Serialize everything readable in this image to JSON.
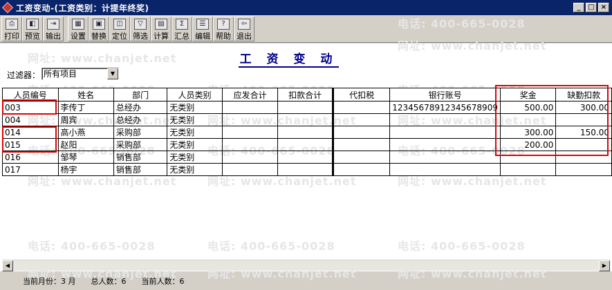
{
  "window": {
    "title": "工资变动-(工资类别：计提年终奖)",
    "minimize": "_",
    "restore": "□",
    "close": "×"
  },
  "toolbar": [
    {
      "label": "打印",
      "icon": "printer-icon",
      "glyph": "⎙"
    },
    {
      "label": "预览",
      "icon": "preview-icon",
      "glyph": "◧"
    },
    {
      "label": "输出",
      "icon": "export-icon",
      "glyph": "⇥"
    },
    {
      "label": "设置",
      "icon": "settings-icon",
      "glyph": "▦"
    },
    {
      "label": "替换",
      "icon": "replace-icon",
      "glyph": "▣"
    },
    {
      "label": "定位",
      "icon": "locate-icon",
      "glyph": "◫"
    },
    {
      "label": "筛选",
      "icon": "filter-icon",
      "glyph": "▽"
    },
    {
      "label": "计算",
      "icon": "calculate-icon",
      "glyph": "▤"
    },
    {
      "label": "汇总",
      "icon": "summary-icon",
      "glyph": "Σ"
    },
    {
      "label": "编辑",
      "icon": "edit-icon",
      "glyph": "☰"
    },
    {
      "label": "帮助",
      "icon": "help-icon",
      "glyph": "?"
    },
    {
      "label": "退出",
      "icon": "exit-icon",
      "glyph": "⇦"
    }
  ],
  "page_title": "工 资 变 动",
  "filter": {
    "label": "过滤器：",
    "value": "所有项目"
  },
  "columns": [
    "人员编号",
    "姓名",
    "部门",
    "人员类别",
    "应发合计",
    "扣款合计",
    "代扣税",
    "银行账号",
    "奖金",
    "缺勤扣款"
  ],
  "rows": [
    [
      "003",
      "李传丁",
      "总经办",
      "无类别",
      "",
      "",
      "",
      "12345678912345678909",
      "500.00",
      "300.00"
    ],
    [
      "004",
      "周宾",
      "总经办",
      "无类别",
      "",
      "",
      "",
      "",
      "",
      ""
    ],
    [
      "014",
      "高小燕",
      "采购部",
      "无类别",
      "",
      "",
      "",
      "",
      "300.00",
      "150.00"
    ],
    [
      "015",
      "赵阳",
      "采购部",
      "无类别",
      "",
      "",
      "",
      "",
      "200.00",
      ""
    ],
    [
      "016",
      "邹琴",
      "销售部",
      "无类别",
      "",
      "",
      "",
      "",
      "",
      ""
    ],
    [
      "017",
      "杨宇",
      "销售部",
      "无类别",
      "",
      "",
      "",
      "",
      "",
      ""
    ]
  ],
  "status": {
    "month": "当前月份：3 月",
    "total": "总人数：6",
    "current": "当前人数：6"
  },
  "watermarks": [
    "电话: 400-665-0028",
    "网址: www.chanjet.net"
  ]
}
